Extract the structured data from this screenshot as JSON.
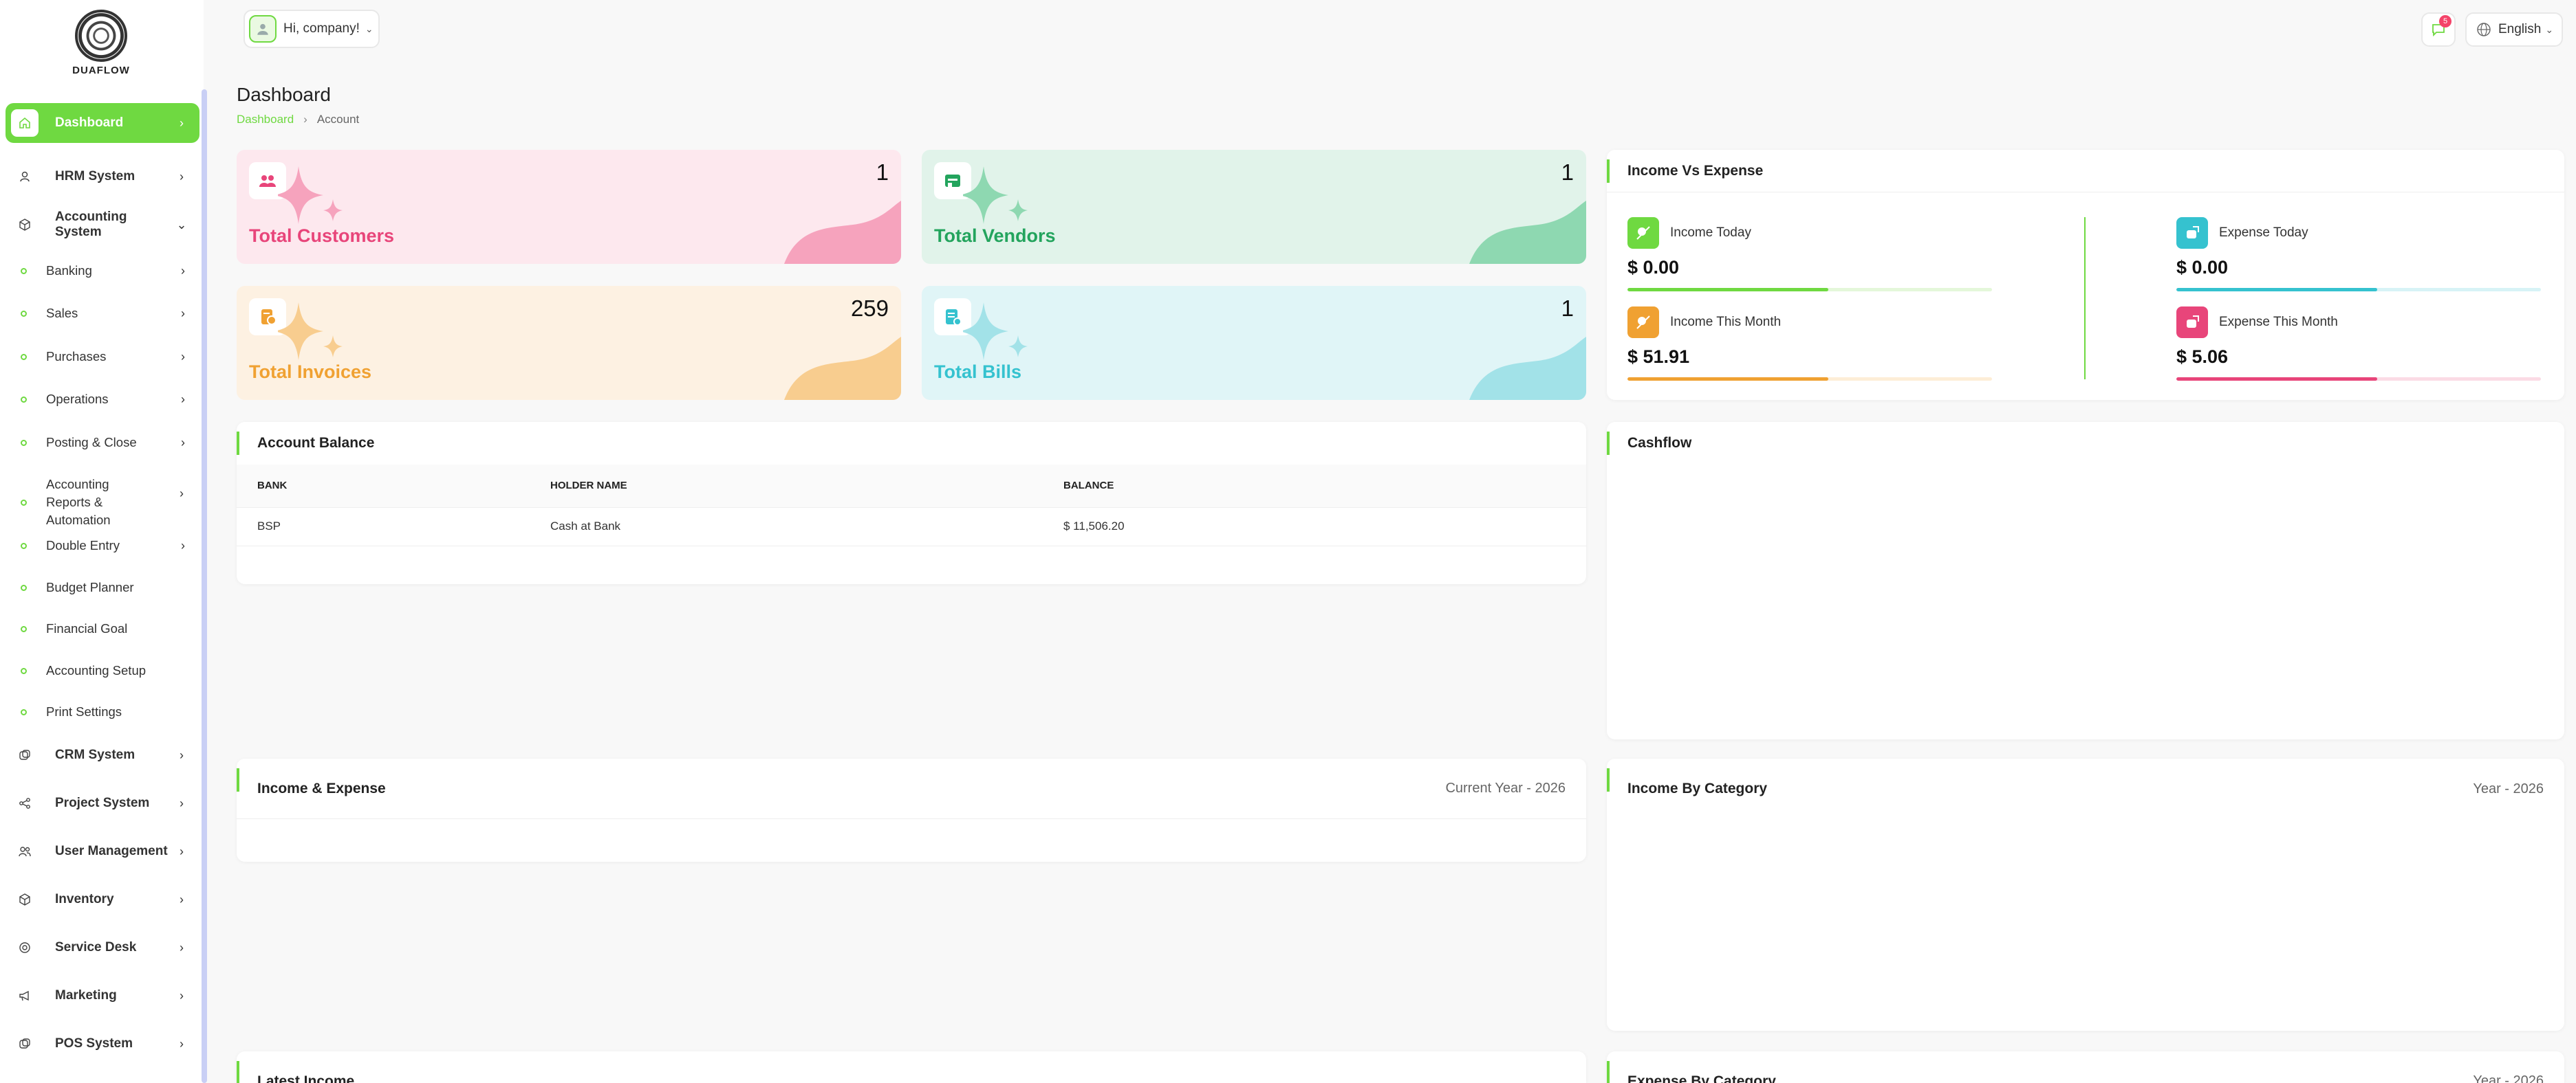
{
  "brand": {
    "name": "DUAFLOW"
  },
  "sidebar": {
    "items": [
      {
        "label": "Dashboard",
        "icon": "home-icon",
        "active": true
      },
      {
        "label": "HRM System",
        "icon": "user-icon"
      },
      {
        "label": "Accounting System",
        "icon": "box-icon",
        "expanded": true
      },
      {
        "label": "CRM System",
        "icon": "layers-icon"
      },
      {
        "label": "Project System",
        "icon": "share-icon"
      },
      {
        "label": "User Management",
        "icon": "users-icon"
      },
      {
        "label": "Inventory",
        "icon": "box-icon"
      },
      {
        "label": "Service Desk",
        "icon": "headset-icon"
      },
      {
        "label": "Marketing",
        "icon": "megaphone-icon"
      },
      {
        "label": "POS System",
        "icon": "layers-icon"
      }
    ],
    "accounting_sub": [
      {
        "label": "Banking",
        "has_children": true
      },
      {
        "label": "Sales",
        "has_children": true
      },
      {
        "label": "Purchases",
        "has_children": true
      },
      {
        "label": "Operations",
        "has_children": true
      },
      {
        "label": "Posting & Close",
        "has_children": true
      },
      {
        "label": "Accounting Reports & Automation",
        "has_children": true
      },
      {
        "label": "Double Entry",
        "has_children": true
      },
      {
        "label": "Budget Planner",
        "has_children": false
      },
      {
        "label": "Financial Goal",
        "has_children": false
      },
      {
        "label": "Accounting Setup",
        "has_children": false
      },
      {
        "label": "Print Settings",
        "has_children": false
      }
    ]
  },
  "topbar": {
    "greeting": "Hi, company!",
    "notification_count": "5",
    "language": "English"
  },
  "page": {
    "title": "Dashboard",
    "breadcrumb": [
      "Dashboard",
      "Account"
    ]
  },
  "stats": [
    {
      "label": "Total Customers",
      "value": "1",
      "color": "#e8457a",
      "bg": "#fde8ee",
      "wave": "#f6a3bd"
    },
    {
      "label": "Total Vendors",
      "value": "1",
      "color": "#23a45d",
      "bg": "#e1f3ea",
      "wave": "#8ed8b1"
    },
    {
      "label": "Total Invoices",
      "value": "259",
      "color": "#f0a132",
      "bg": "#fdf1e2",
      "wave": "#f8cd8f"
    },
    {
      "label": "Total Bills",
      "value": "1",
      "color": "#35c2cf",
      "bg": "#e0f5f7",
      "wave": "#a2e2e8"
    }
  ],
  "income_vs_expense": {
    "title": "Income Vs Expense",
    "items": [
      {
        "label": "Income Today",
        "value": "$ 0.00",
        "color": "#6fd941",
        "track": "#e4f7da",
        "fill_pct": 55
      },
      {
        "label": "Expense Today",
        "value": "$ 0.00",
        "color": "#35c2cf",
        "track": "#d7f3f6",
        "fill_pct": 55
      },
      {
        "label": "Income This Month",
        "value": "$ 51.91",
        "color": "#f0a132",
        "track": "#fdeed7",
        "fill_pct": 55
      },
      {
        "label": "Expense This Month",
        "value": "$ 5.06",
        "color": "#e8457a",
        "track": "#fbdbe5",
        "fill_pct": 55
      }
    ]
  },
  "account_balance": {
    "title": "Account Balance",
    "columns": [
      "BANK",
      "HOLDER NAME",
      "BALANCE"
    ],
    "rows": [
      [
        "BSP",
        "Cash at Bank",
        "$ 11,506.20"
      ]
    ]
  },
  "cashflow": {
    "title": "Cashflow"
  },
  "income_expense": {
    "title": "Income & Expense",
    "meta": "Current Year - 2026"
  },
  "income_by_category": {
    "title": "Income By Category",
    "meta": "Year - 2026"
  },
  "latest_income": {
    "title": "Latest Income"
  },
  "expense_by_category": {
    "title": "Expense By Category",
    "meta": "Year - 2026"
  }
}
